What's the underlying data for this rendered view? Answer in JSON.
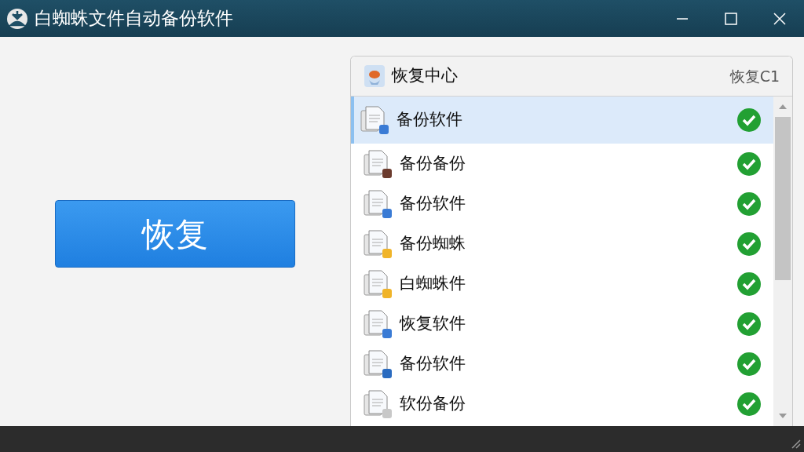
{
  "window": {
    "title": "白蜘蛛文件自动备份软件"
  },
  "restore_button": {
    "label": "恢复"
  },
  "panel": {
    "title": "恢复中心",
    "subtitle": "恢复C1",
    "items": [
      {
        "label": "备份软件",
        "selected": true,
        "ok": true,
        "color": "#3a7bd5"
      },
      {
        "label": "备份备份",
        "selected": false,
        "ok": true,
        "color": "#6b3b2e"
      },
      {
        "label": "备份软件",
        "selected": false,
        "ok": true,
        "color": "#3a7bd5"
      },
      {
        "label": "备份蜘蛛",
        "selected": false,
        "ok": true,
        "color": "#f0b429"
      },
      {
        "label": "白蜘蛛件",
        "selected": false,
        "ok": true,
        "color": "#f0b429"
      },
      {
        "label": "恢复软件",
        "selected": false,
        "ok": true,
        "color": "#3a7bd5"
      },
      {
        "label": "备份软件",
        "selected": false,
        "ok": true,
        "color": "#2a6bc0"
      },
      {
        "label": "软份备份",
        "selected": false,
        "ok": true,
        "color": "#c8c8c8"
      }
    ]
  }
}
